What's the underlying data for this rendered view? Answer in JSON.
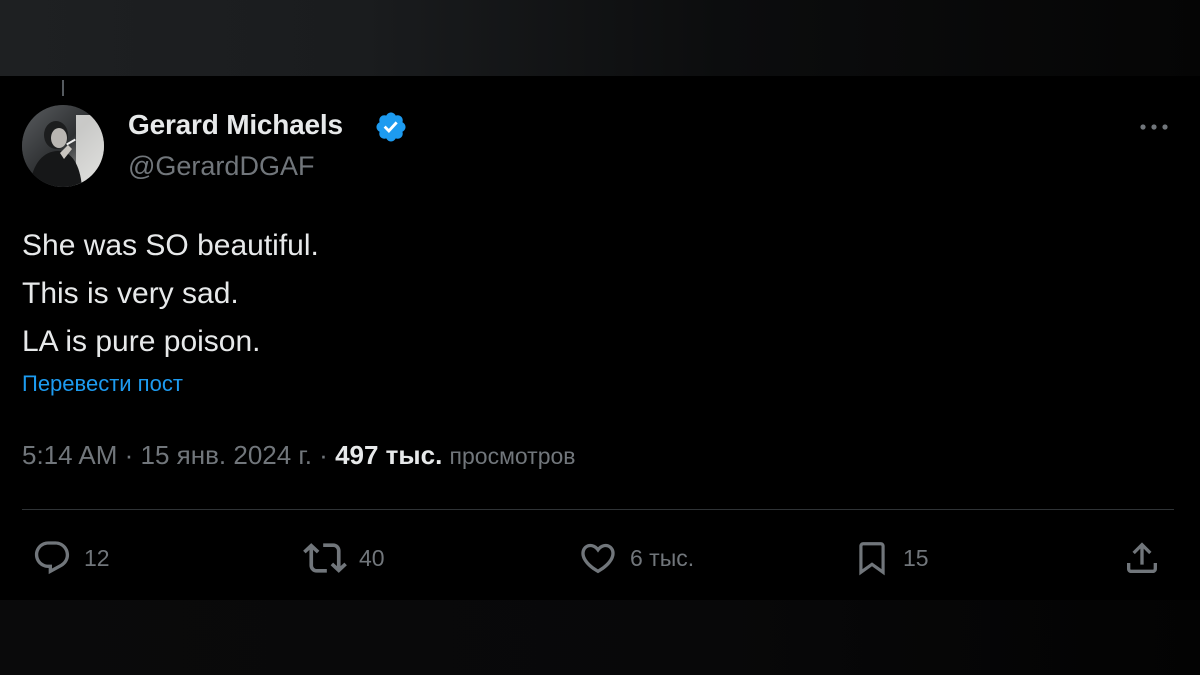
{
  "post": {
    "author": {
      "name": "Gerard Michaels",
      "handle": "@GerardDGAF",
      "verified": true
    },
    "text_lines": [
      "She was SO beautiful.",
      "This is very sad.",
      "LA is pure poison."
    ],
    "translate_label": "Перевести пост",
    "meta": {
      "time": "5:14 AM",
      "date": "15 янв. 2024 г.",
      "separator": " · ",
      "views_count": "497 тыс.",
      "views_label": "просмотров"
    },
    "actions": {
      "reply": {
        "icon": "reply-icon",
        "count": "12"
      },
      "repost": {
        "icon": "repost-icon",
        "count": "40"
      },
      "like": {
        "icon": "heart-icon",
        "count": "6 тыс."
      },
      "bookmark": {
        "icon": "bookmark-icon",
        "count": "15"
      },
      "share": {
        "icon": "share-icon"
      }
    }
  },
  "colors": {
    "background": "#000000",
    "text_primary": "#e7e9ea",
    "text_secondary": "#71767b",
    "accent": "#1d9bf0",
    "divider": "#2f3336"
  }
}
